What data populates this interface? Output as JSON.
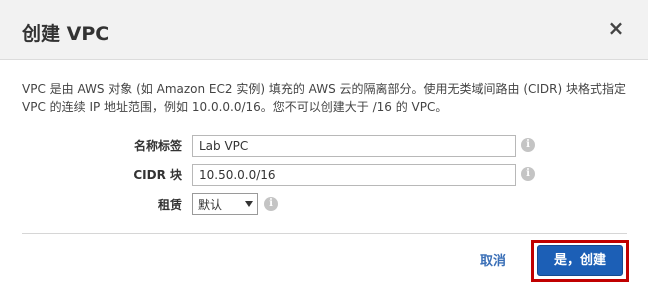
{
  "dialog": {
    "title": "创建 VPC",
    "close_glyph": "×",
    "description": "VPC 是由 AWS 对象 (如 Amazon EC2 实例) 填充的 AWS 云的隔离部分。使用无类域间路由 (CIDR) 块格式指定 VPC 的连续 IP 地址范围，例如 10.0.0.0/16。您不可以创建大于 /16 的 VPC。"
  },
  "form": {
    "name_tag": {
      "label": "名称标签",
      "value": "Lab VPC"
    },
    "cidr": {
      "label": "CIDR 块",
      "value": "10.50.0.0/16"
    },
    "tenancy": {
      "label": "租赁",
      "value": "默认"
    },
    "info_glyph": "i",
    "info_icon": "info-icon"
  },
  "footer": {
    "cancel_label": "取消",
    "create_label": "是，创建"
  },
  "colors": {
    "primary_button": "#1c5fb6",
    "highlight_outline": "#c00000",
    "link": "#3a6fb7"
  }
}
